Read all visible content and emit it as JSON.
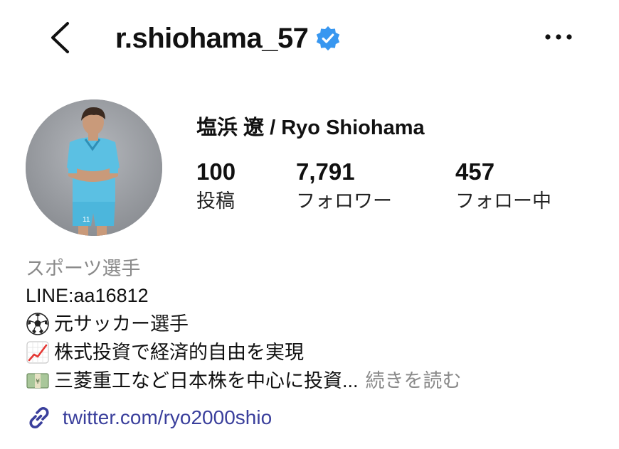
{
  "header": {
    "username": "r.shiohama_57",
    "back_icon": "chevron-left-icon",
    "verified_icon": "verified-badge-icon",
    "more_icon": "more-horizontal-icon",
    "verified_color": "#3897f0"
  },
  "profile": {
    "display_name": "塩浜 遼 / Ryo Shiohama",
    "stats": [
      {
        "value": "100",
        "label": "投稿"
      },
      {
        "value": "7,791",
        "label": "フォロワー"
      },
      {
        "value": "457",
        "label": "フォロー中"
      }
    ]
  },
  "bio": {
    "category": "スポーツ選手",
    "lines": [
      {
        "text": "LINE:aa16812"
      },
      {
        "emoji": "soccer-ball-icon",
        "text": "元サッカー選手"
      },
      {
        "emoji": "chart-increasing-icon",
        "text": "株式投資で経済的自由を実現"
      },
      {
        "emoji": "money-bag-icon",
        "text": "三菱重工など日本株を中心に投資..."
      }
    ],
    "more_label": "続きを読む"
  },
  "link": {
    "icon": "link-icon",
    "text": "twitter.com/ryo2000shio",
    "color": "#3a3f9c"
  }
}
